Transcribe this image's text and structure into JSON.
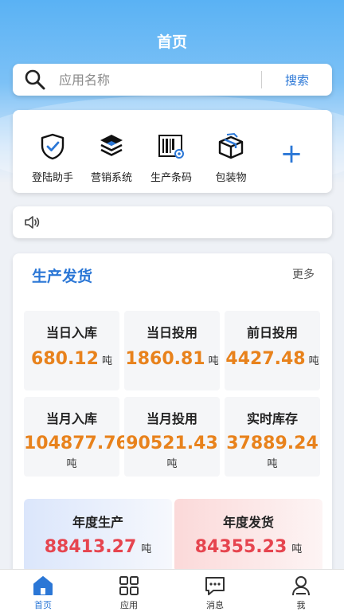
{
  "header": {
    "title": "首页"
  },
  "search": {
    "placeholder": "应用名称",
    "button_label": "搜索"
  },
  "apps": [
    {
      "label": "登陆助手",
      "icon": "shield-check-icon"
    },
    {
      "label": "营销系统",
      "icon": "layers-icon"
    },
    {
      "label": "生产条码",
      "icon": "barcode-icon"
    },
    {
      "label": "包装物",
      "icon": "package-icon"
    }
  ],
  "add_button": {
    "icon": "plus-icon",
    "label": "+"
  },
  "notice": {
    "icon": "speaker-icon"
  },
  "production": {
    "title": "生产发货",
    "more_label": "更多",
    "stats": [
      {
        "label": "当日入库",
        "value": "680.12",
        "unit": "吨"
      },
      {
        "label": "当日投用",
        "value": "1860.81",
        "unit": "吨"
      },
      {
        "label": "前日投用",
        "value": "4427.48",
        "unit": "吨"
      },
      {
        "label": "当月入库",
        "value": "104877.76",
        "unit": "吨"
      },
      {
        "label": "当月投用",
        "value": "90521.43",
        "unit": "吨"
      },
      {
        "label": "实时库存",
        "value": "37889.24",
        "unit": "吨"
      }
    ],
    "yearly": [
      {
        "label": "年度生产",
        "value": "88413.27",
        "unit": "吨"
      },
      {
        "label": "年度发货",
        "value": "84355.23",
        "unit": "吨"
      }
    ]
  },
  "tabbar": [
    {
      "label": "首页",
      "icon": "home-icon",
      "active": true
    },
    {
      "label": "应用",
      "icon": "grid-icon",
      "active": false
    },
    {
      "label": "消息",
      "icon": "message-icon",
      "active": false
    },
    {
      "label": "我",
      "icon": "user-icon",
      "active": false
    }
  ],
  "colors": {
    "accent": "#2b77d6",
    "value_orange": "#e8821c",
    "value_red": "#e6454f"
  }
}
